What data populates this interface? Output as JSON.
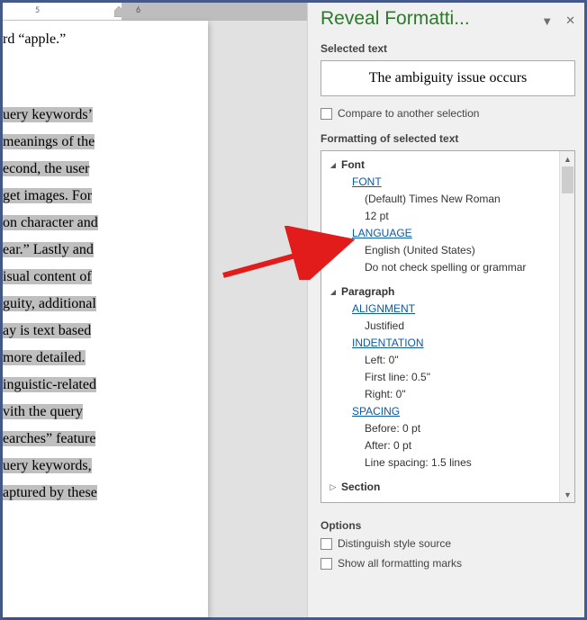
{
  "ruler": {
    "mark1": "5",
    "mark2": "6"
  },
  "document": {
    "line0": "rd “apple.”",
    "lines_selected": [
      "uery keywords’",
      "meanings of the",
      "econd, the user",
      "get images. For",
      "on character and",
      "ear.” Lastly and",
      "isual content of",
      "guity, additional",
      "ay is text based",
      " more detailed.",
      "inguistic-related",
      "vith the query",
      "earches” feature",
      "uery keywords,",
      "aptured by these"
    ]
  },
  "panel": {
    "title": "Reveal Formatti...",
    "selected_text_label": "Selected text",
    "selected_text_value": "The ambiguity issue occurs",
    "compare_label": "Compare to another selection",
    "formatting_label": "Formatting of selected text",
    "options_label": "Options",
    "distinguish_label": "Distinguish style source",
    "show_all_label": "Show all formatting marks"
  },
  "tree": {
    "font": {
      "label": "Font",
      "font_link": "FONT",
      "font_value": "(Default) Times New Roman",
      "font_size": "12 pt",
      "language_link": "LANGUAGE",
      "language_value": "English (United States)",
      "spell_value": "Do not check spelling or grammar"
    },
    "paragraph": {
      "label": "Paragraph",
      "alignment_link": "ALIGNMENT",
      "alignment_value": "Justified",
      "indentation_link": "INDENTATION",
      "indent_left": "Left:  0\"",
      "indent_first": "First line:  0.5\"",
      "indent_right": "Right:  0\"",
      "spacing_link": "SPACING",
      "spacing_before": "Before:  0 pt",
      "spacing_after": "After:  0 pt",
      "line_spacing": "Line spacing:  1.5 lines"
    },
    "section": {
      "label": "Section"
    }
  }
}
